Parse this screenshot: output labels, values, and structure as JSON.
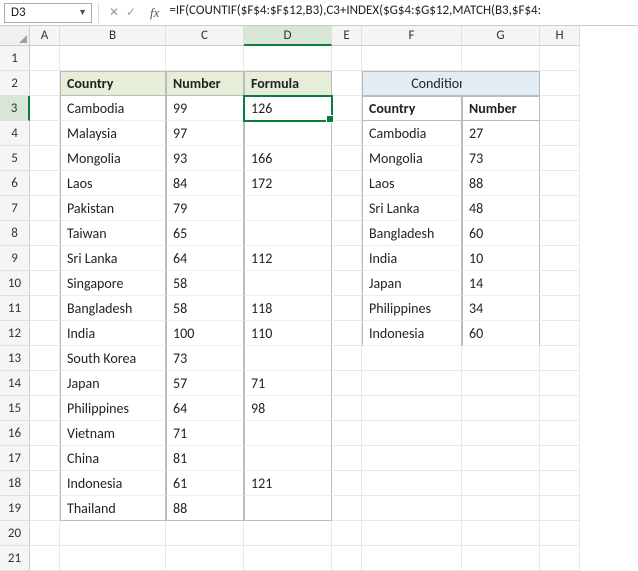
{
  "namebox": "D3",
  "formula": "=IF(COUNTIF($F$4:$F$12,B3),C3+INDEX($G$4:$G$12,MATCH(B3,$F$4:",
  "cols": {
    "A": "A",
    "B": "B",
    "C": "C",
    "D": "D",
    "E": "E",
    "F": "F",
    "G": "G",
    "H": "H"
  },
  "rows": [
    "1",
    "2",
    "3",
    "4",
    "5",
    "6",
    "7",
    "8",
    "9",
    "10",
    "11",
    "12",
    "13",
    "14",
    "15",
    "16",
    "17",
    "18",
    "19",
    "20",
    "21"
  ],
  "headers1": {
    "B": "Country",
    "C": "Number",
    "D": "Formula"
  },
  "cond_title": "Conditions",
  "headers2": {
    "F": "Country",
    "G": "Number"
  },
  "t1": [
    {
      "b": "Cambodia",
      "c": "99",
      "d": "126"
    },
    {
      "b": "Malaysia",
      "c": "97",
      "d": ""
    },
    {
      "b": "Mongolia",
      "c": "93",
      "d": "166"
    },
    {
      "b": "Laos",
      "c": "84",
      "d": "172"
    },
    {
      "b": "Pakistan",
      "c": "79",
      "d": ""
    },
    {
      "b": "Taiwan",
      "c": "65",
      "d": ""
    },
    {
      "b": "Sri Lanka",
      "c": "64",
      "d": "112"
    },
    {
      "b": "Singapore",
      "c": "58",
      "d": ""
    },
    {
      "b": "Bangladesh",
      "c": "58",
      "d": "118"
    },
    {
      "b": "India",
      "c": "100",
      "d": "110"
    },
    {
      "b": "South Korea",
      "c": "73",
      "d": ""
    },
    {
      "b": "Japan",
      "c": "57",
      "d": "71"
    },
    {
      "b": "Philippines",
      "c": "64",
      "d": "98"
    },
    {
      "b": "Vietnam",
      "c": "71",
      "d": ""
    },
    {
      "b": "China",
      "c": "81",
      "d": ""
    },
    {
      "b": "Indonesia",
      "c": "61",
      "d": "121"
    },
    {
      "b": "Thailand",
      "c": "88",
      "d": ""
    }
  ],
  "t2": [
    {
      "f": "Cambodia",
      "g": "27"
    },
    {
      "f": "Mongolia",
      "g": "73"
    },
    {
      "f": "Laos",
      "g": "88"
    },
    {
      "f": "Sri Lanka",
      "g": "48"
    },
    {
      "f": "Bangladesh",
      "g": "60"
    },
    {
      "f": "India",
      "g": "10"
    },
    {
      "f": "Japan",
      "g": "14"
    },
    {
      "f": "Philippines",
      "g": "34"
    },
    {
      "f": "Indonesia",
      "g": "60"
    }
  ]
}
